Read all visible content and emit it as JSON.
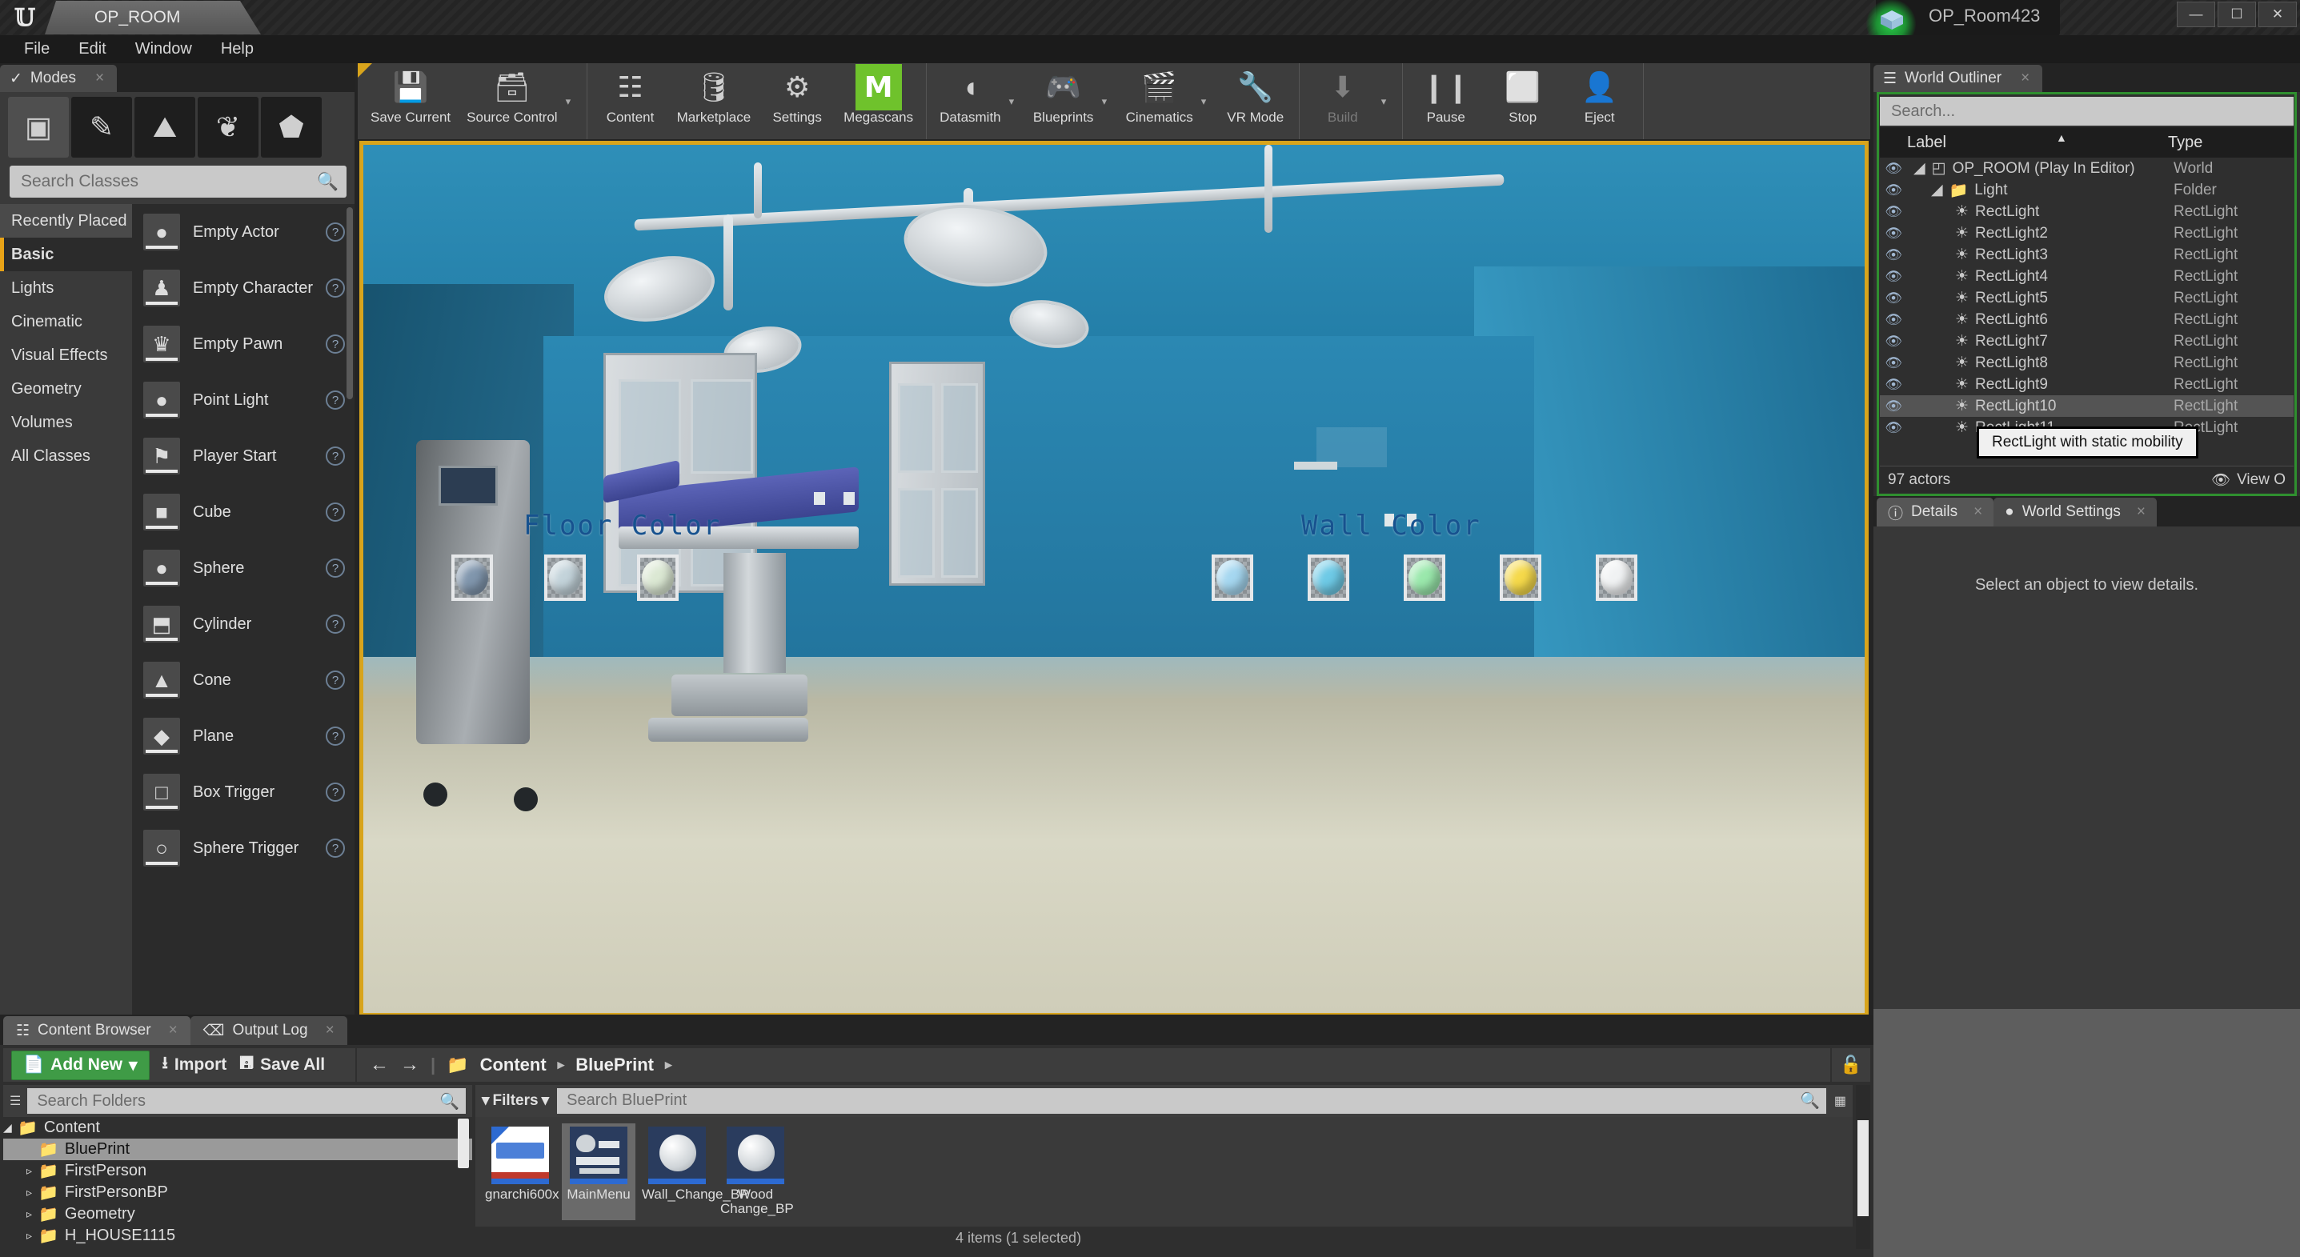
{
  "titlebar": {
    "project_tab": "OP_ROOM",
    "pie_session": "OP_Room423",
    "logo": "unreal-logo",
    "window_buttons": [
      {
        "name": "minimize",
        "glyph": "—"
      },
      {
        "name": "maximize",
        "glyph": "❐"
      },
      {
        "name": "close",
        "glyph": "✕"
      }
    ]
  },
  "menubar": {
    "items": [
      "File",
      "Edit",
      "Window",
      "Help"
    ]
  },
  "modes": {
    "tab_label": "Modes",
    "close_glyph": "×",
    "mode_icons": [
      {
        "name": "place-mode-icon",
        "glyph": "▣",
        "selected": true
      },
      {
        "name": "paint-mode-icon",
        "glyph": "✎",
        "selected": false
      },
      {
        "name": "landscape-mode-icon",
        "glyph": "⛰",
        "selected": false
      },
      {
        "name": "foliage-mode-icon",
        "glyph": "❦",
        "selected": false
      },
      {
        "name": "geometry-edit-mode-icon",
        "glyph": "⬟",
        "selected": false
      }
    ],
    "search_placeholder": "Search Classes",
    "categories": [
      {
        "label": "Recently Placed",
        "state": "hover"
      },
      {
        "label": "Basic",
        "state": "selected"
      },
      {
        "label": "Lights",
        "state": "normal"
      },
      {
        "label": "Cinematic",
        "state": "normal"
      },
      {
        "label": "Visual Effects",
        "state": "normal"
      },
      {
        "label": "Geometry",
        "state": "normal"
      },
      {
        "label": "Volumes",
        "state": "normal"
      },
      {
        "label": "All Classes",
        "state": "normal"
      }
    ],
    "items": [
      {
        "label": "Empty Actor",
        "icon": "●"
      },
      {
        "label": "Empty Character",
        "icon": "♟"
      },
      {
        "label": "Empty Pawn",
        "icon": "♛"
      },
      {
        "label": "Point Light",
        "icon": "●"
      },
      {
        "label": "Player Start",
        "icon": "⚑"
      },
      {
        "label": "Cube",
        "icon": "■"
      },
      {
        "label": "Sphere",
        "icon": "●"
      },
      {
        "label": "Cylinder",
        "icon": "⬒"
      },
      {
        "label": "Cone",
        "icon": "▲"
      },
      {
        "label": "Plane",
        "icon": "◆"
      },
      {
        "label": "Box Trigger",
        "icon": "□"
      },
      {
        "label": "Sphere Trigger",
        "icon": "○"
      }
    ],
    "help_glyph": "?"
  },
  "toolbar": {
    "groups": [
      {
        "buttons": [
          {
            "label": "Save Current",
            "icon": "save-icon",
            "glyph": "💾",
            "caret": false,
            "disabled": false
          },
          {
            "label": "Source Control",
            "icon": "source-control-icon",
            "glyph": "🗃",
            "caret": true,
            "disabled": false
          }
        ]
      },
      {
        "buttons": [
          {
            "label": "Content",
            "icon": "content-icon",
            "glyph": "☷",
            "caret": false,
            "disabled": false
          },
          {
            "label": "Marketplace",
            "icon": "marketplace-icon",
            "glyph": "🛢",
            "caret": false,
            "disabled": false
          },
          {
            "label": "Settings",
            "icon": "settings-icon",
            "glyph": "⚙",
            "caret": false,
            "disabled": false
          },
          {
            "label": "Megascans",
            "icon": "megascans-icon",
            "glyph": "M",
            "caret": false,
            "disabled": false
          }
        ]
      },
      {
        "buttons": [
          {
            "label": "Datasmith",
            "icon": "datasmith-icon",
            "glyph": "◖",
            "caret": true,
            "disabled": false
          },
          {
            "label": "Blueprints",
            "icon": "blueprints-icon",
            "glyph": "🎮",
            "caret": true,
            "disabled": false
          },
          {
            "label": "Cinematics",
            "icon": "cinematics-icon",
            "glyph": "🎬",
            "caret": true,
            "disabled": false
          },
          {
            "label": "VR Mode",
            "icon": "vr-mode-icon",
            "glyph": "🔧",
            "caret": false,
            "disabled": false
          }
        ]
      },
      {
        "buttons": [
          {
            "label": "Build",
            "icon": "build-icon",
            "glyph": "⬇",
            "caret": true,
            "disabled": true
          }
        ]
      },
      {
        "buttons": [
          {
            "label": "Pause",
            "icon": "pause-icon",
            "glyph": "❙❙",
            "caret": false,
            "disabled": false
          },
          {
            "label": "Stop",
            "icon": "stop-icon",
            "glyph": "⬜",
            "caret": false,
            "disabled": false
          },
          {
            "label": "Eject",
            "icon": "eject-icon",
            "glyph": "👤",
            "caret": false,
            "disabled": false
          }
        ]
      }
    ]
  },
  "viewport": {
    "floor_color_label": "Floor Color",
    "wall_color_label": "Wall Color",
    "floor_swatches": [
      {
        "name": "floor-swatch-slate-blue",
        "color": "#8096ad"
      },
      {
        "name": "floor-swatch-pale-blue",
        "color": "#c3d3da"
      },
      {
        "name": "floor-swatch-mint-white",
        "color": "#dbe8d3"
      }
    ],
    "wall_swatches": [
      {
        "name": "wall-swatch-light-blue",
        "color": "#a5d7f0"
      },
      {
        "name": "wall-swatch-cyan",
        "color": "#6ecae6"
      },
      {
        "name": "wall-swatch-green",
        "color": "#9ae8ac"
      },
      {
        "name": "wall-swatch-yellow",
        "color": "#f5d94a"
      },
      {
        "name": "wall-swatch-white",
        "color": "#f0f2f3"
      }
    ],
    "wall_color_hex": "#2a86b0",
    "floor_color_hex": "#cfcdb9"
  },
  "outliner": {
    "tab_label": "World Outliner",
    "close_glyph": "×",
    "search_placeholder": "Search...",
    "columns": {
      "label": "Label",
      "type": "Type"
    },
    "sort_arrow": "▲",
    "rows": [
      {
        "label": "OP_ROOM (Play In Editor)",
        "type": "World",
        "depth": 0,
        "icon": "world-icon",
        "glyph": "◰",
        "selected": false,
        "expander": "◢"
      },
      {
        "label": "Light",
        "type": "Folder",
        "depth": 1,
        "icon": "folder-icon",
        "glyph": "📁",
        "selected": false,
        "expander": "◢"
      },
      {
        "label": "RectLight",
        "type": "RectLight",
        "depth": 2,
        "icon": "rectlight-icon",
        "glyph": "☀",
        "selected": false,
        "expander": ""
      },
      {
        "label": "RectLight2",
        "type": "RectLight",
        "depth": 2,
        "icon": "rectlight-icon",
        "glyph": "☀",
        "selected": false,
        "expander": ""
      },
      {
        "label": "RectLight3",
        "type": "RectLight",
        "depth": 2,
        "icon": "rectlight-icon",
        "glyph": "☀",
        "selected": false,
        "expander": ""
      },
      {
        "label": "RectLight4",
        "type": "RectLight",
        "depth": 2,
        "icon": "rectlight-icon",
        "glyph": "☀",
        "selected": false,
        "expander": ""
      },
      {
        "label": "RectLight5",
        "type": "RectLight",
        "depth": 2,
        "icon": "rectlight-icon",
        "glyph": "☀",
        "selected": false,
        "expander": ""
      },
      {
        "label": "RectLight6",
        "type": "RectLight",
        "depth": 2,
        "icon": "rectlight-icon",
        "glyph": "☀",
        "selected": false,
        "expander": ""
      },
      {
        "label": "RectLight7",
        "type": "RectLight",
        "depth": 2,
        "icon": "rectlight-icon",
        "glyph": "☀",
        "selected": false,
        "expander": ""
      },
      {
        "label": "RectLight8",
        "type": "RectLight",
        "depth": 2,
        "icon": "rectlight-icon",
        "glyph": "☀",
        "selected": false,
        "expander": ""
      },
      {
        "label": "RectLight9",
        "type": "RectLight",
        "depth": 2,
        "icon": "rectlight-icon",
        "glyph": "☀",
        "selected": false,
        "expander": ""
      },
      {
        "label": "RectLight10",
        "type": "RectLight",
        "depth": 2,
        "icon": "rectlight-icon",
        "glyph": "☀",
        "selected": true,
        "expander": ""
      },
      {
        "label": "RectLight11",
        "type": "RectLight",
        "depth": 2,
        "icon": "rectlight-icon",
        "glyph": "☀",
        "selected": false,
        "expander": ""
      }
    ],
    "tooltip": "RectLight with static mobility",
    "actor_count": "97 actors",
    "view_options": "View O",
    "view_options_icon": "eye-icon"
  },
  "details": {
    "tabs": [
      {
        "label": "Details",
        "icon": "details-icon",
        "glyph": "ⓘ",
        "active": true,
        "close": "×"
      },
      {
        "label": "World Settings",
        "icon": "globe-icon",
        "glyph": "●",
        "active": false,
        "close": "×"
      }
    ],
    "empty_message": "Select an object to view details."
  },
  "content_browser": {
    "tabs": [
      {
        "label": "Content Browser",
        "icon": "content-browser-icon",
        "glyph": "☷",
        "active": true,
        "close": "×"
      },
      {
        "label": "Output Log",
        "icon": "output-log-icon",
        "glyph": "⌫",
        "active": false,
        "close": "×"
      }
    ],
    "add_new_label": "Add New",
    "add_new_caret": "▾",
    "import_label": "Import",
    "save_all_label": "Save All",
    "nav_back": "←",
    "nav_forward": "→",
    "breadcrumb": [
      "Content",
      "BluePrint"
    ],
    "breadcrumb_sep": "▸",
    "lock_icon": "lock-icon",
    "folder_search_placeholder": "Search Folders",
    "folder_tree": [
      {
        "label": "Content",
        "depth": 0,
        "expander": "◢",
        "selected": false
      },
      {
        "label": "BluePrint",
        "depth": 1,
        "expander": "",
        "selected": true
      },
      {
        "label": "FirstPerson",
        "depth": 1,
        "expander": "▹",
        "selected": false
      },
      {
        "label": "FirstPersonBP",
        "depth": 1,
        "expander": "▹",
        "selected": false
      },
      {
        "label": "Geometry",
        "depth": 1,
        "expander": "▹",
        "selected": false
      },
      {
        "label": "H_HOUSE1115",
        "depth": 1,
        "expander": "▹",
        "selected": false
      }
    ],
    "filters_label": "Filters",
    "filters_caret": "▾",
    "asset_search_placeholder": "Search BluePrint",
    "assets": [
      {
        "label": "gnarchi600x",
        "type": "texture",
        "selected": false
      },
      {
        "label": "MainMenu",
        "type": "widget",
        "selected": true
      },
      {
        "label": "Wall_Change_BP",
        "type": "blueprint",
        "selected": false
      },
      {
        "label": "Wood Change_BP",
        "type": "blueprint",
        "selected": false
      }
    ],
    "status": "4 items (1 selected)"
  }
}
